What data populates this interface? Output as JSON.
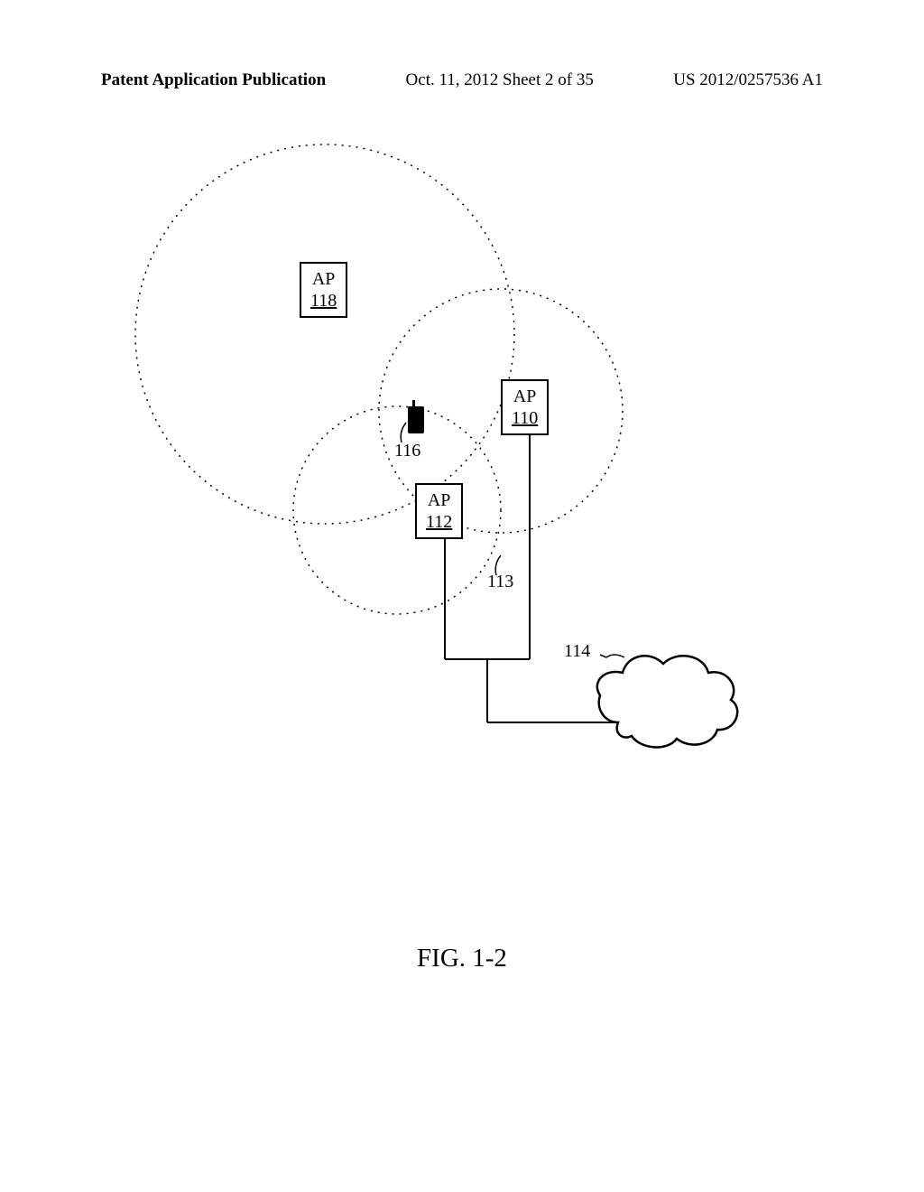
{
  "header": {
    "left": "Patent Application Publication",
    "center": "Oct. 11, 2012  Sheet 2 of 35",
    "right": "US 2012/0257536 A1"
  },
  "figure": {
    "label": "FIG. 1-2"
  },
  "ap118": {
    "label": "AP",
    "number": "118"
  },
  "ap110": {
    "label": "AP",
    "number": "110"
  },
  "ap112": {
    "label": "AP",
    "number": "112"
  },
  "refs": {
    "r116": "116",
    "r113": "113",
    "r114": "114"
  }
}
